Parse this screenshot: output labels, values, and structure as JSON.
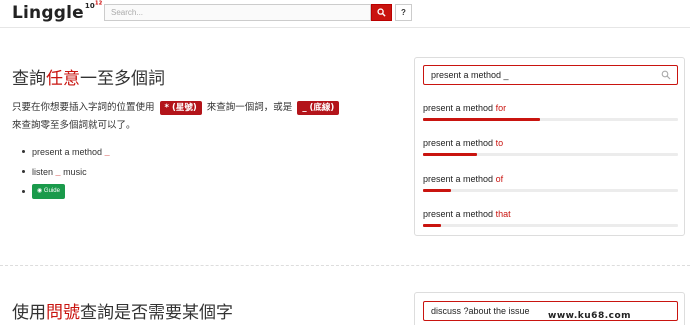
{
  "header": {
    "logo_text": "Linggle",
    "logo_sup": "10",
    "logo_sup_small": "12",
    "search_placeholder": "Search...",
    "help_label": "?"
  },
  "section1": {
    "title_pre": "查詢",
    "title_hl": "任意",
    "title_post": "一至多個詞",
    "desc_1": "只要在你想要插入字詞的位置使用",
    "tag_star": "* (星號)",
    "desc_2": "來查詢一個詞，或是",
    "tag_underscore": "_ (底線)",
    "desc_3": "來查詢零至多個詞就可以了。",
    "examples": [
      {
        "text": "present a method",
        "wild": "_"
      },
      {
        "text": "listen",
        "wild": "_",
        "after": "music"
      }
    ],
    "guide_label": "Guide"
  },
  "panel1": {
    "query": "present a method _",
    "results": [
      {
        "prefix": "present a method",
        "word": "for",
        "fraction": 0.46
      },
      {
        "prefix": "present a method",
        "word": "to",
        "fraction": 0.21
      },
      {
        "prefix": "present a method",
        "word": "of",
        "fraction": 0.11
      },
      {
        "prefix": "present a method",
        "word": "that",
        "fraction": 0.07
      }
    ]
  },
  "section2": {
    "title_pre": "使用",
    "title_hl": "問號",
    "title_post": "查詢是否需要某個字",
    "query": "discuss ?about the issue"
  },
  "watermark": "www.ku68.com",
  "colors": {
    "accent": "#c9140f",
    "guide": "#1a9a4b"
  }
}
